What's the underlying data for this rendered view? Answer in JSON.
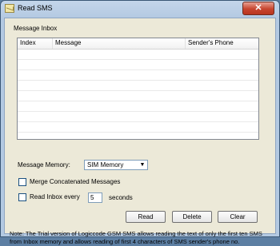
{
  "window": {
    "title": "Read SMS",
    "ghost_title": "",
    "close_symbol": "✕"
  },
  "inbox": {
    "group_label": "Message Inbox",
    "columns": [
      "Index",
      "Message",
      "Sender's Phone"
    ],
    "rows": []
  },
  "options": {
    "memory_label": "Message Memory:",
    "memory_selected": "SIM Memory",
    "merge_label": "Merge Concatenated Messages",
    "merge_checked": false,
    "read_every_label": "Read Inbox every",
    "read_every_value": "5",
    "seconds_label": "seconds",
    "read_every_checked": false
  },
  "buttons": {
    "read": "Read",
    "delete": "Delete",
    "clear": "Clear"
  },
  "note": "Note: The Trial version of Logiccode GSM SMS allows reading the text of only the first ten SMS from Inbox memory and allows reading of first 4 characters of SMS sender's phone no."
}
